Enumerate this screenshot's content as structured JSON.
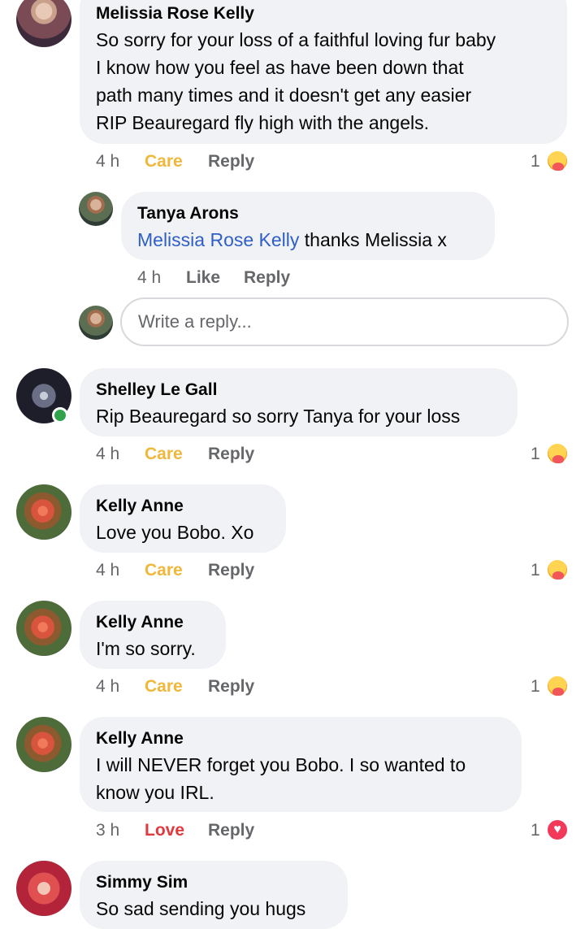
{
  "comments": [
    {
      "name": "Melissia Rose Kelly",
      "lines": [
        "So sorry for your loss of a faithful loving fur baby",
        "I know how you feel as have been down that",
        "path many times and it doesn't get any easier",
        "RIP Beauregard fly high with the angels."
      ],
      "time": "4 h",
      "reaction_label": "Care",
      "reply_label": "Reply",
      "count": "1",
      "reaction_icon": "care-emoji-icon"
    },
    {
      "name": "Tanya Arons",
      "mention": "Melissia Rose Kelly",
      "text": " thanks Melissia x",
      "time": "4 h",
      "reaction_label": "Like",
      "reply_label": "Reply"
    },
    {
      "name": "Shelley Le Gall",
      "lines": [
        "Rip Beauregard so sorry Tanya for your loss"
      ],
      "time": "4 h",
      "reaction_label": "Care",
      "reply_label": "Reply",
      "count": "1",
      "reaction_icon": "care-emoji-icon"
    },
    {
      "name": "Kelly Anne",
      "lines": [
        "Love you Bobo. Xo"
      ],
      "time": "4 h",
      "reaction_label": "Care",
      "reply_label": "Reply",
      "count": "1",
      "reaction_icon": "care-emoji-icon"
    },
    {
      "name": "Kelly Anne",
      "lines": [
        "I'm so sorry."
      ],
      "time": "4 h",
      "reaction_label": "Care",
      "reply_label": "Reply",
      "count": "1",
      "reaction_icon": "care-emoji-icon"
    },
    {
      "name": "Kelly Anne",
      "lines": [
        "I will NEVER forget you Bobo. I so wanted to",
        "know you IRL."
      ],
      "time": "3 h",
      "reaction_label": "Love",
      "reply_label": "Reply",
      "count": "1",
      "reaction_icon": "love-emoji-icon"
    },
    {
      "name": "Simmy Sim",
      "lines": [
        "So sad sending you hugs"
      ]
    }
  ],
  "reply_box": {
    "placeholder": "Write a reply..."
  },
  "colors": {
    "care": "#f0b73a",
    "love": "#e0393e",
    "mention": "#2f5fc6",
    "bubble": "#f0f2f5",
    "online": "#31a24c"
  }
}
